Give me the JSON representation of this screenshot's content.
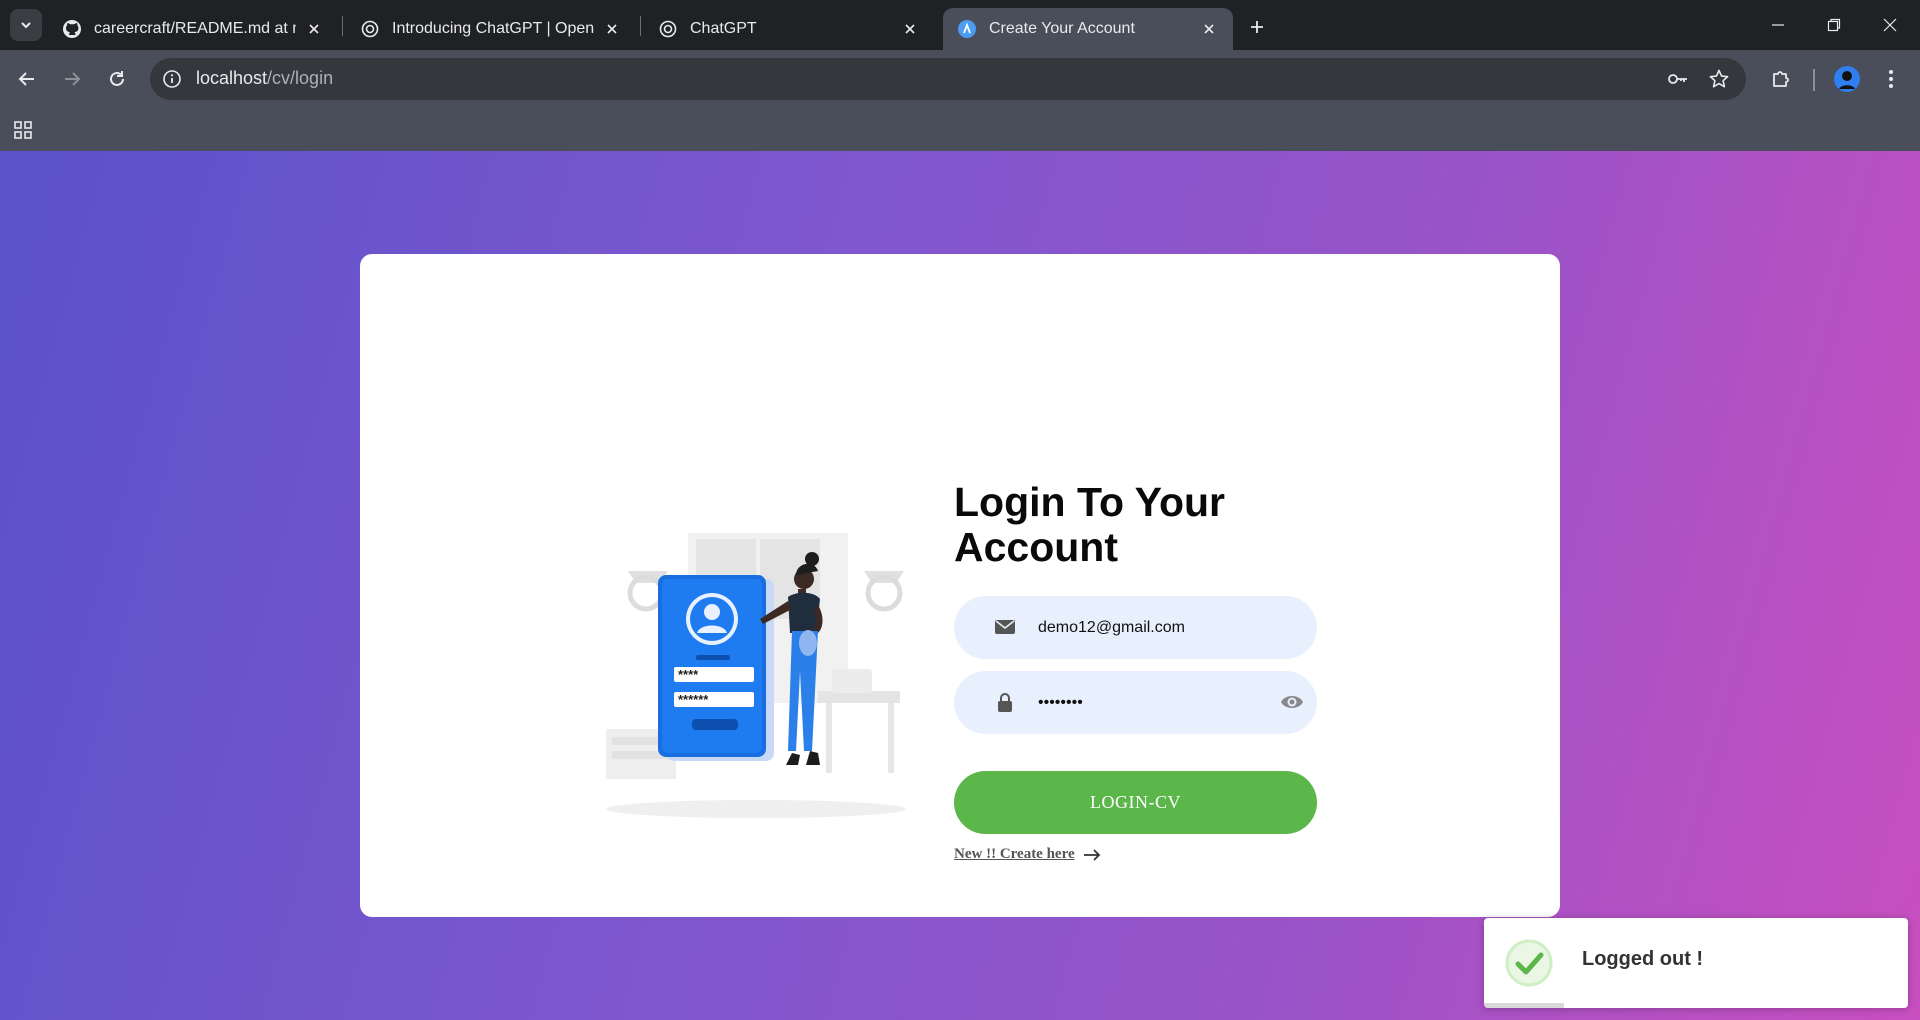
{
  "browser": {
    "tabs": [
      {
        "title": "careercraft/README.md at main",
        "icon": "github-icon",
        "active": false
      },
      {
        "title": "Introducing ChatGPT | OpenAI",
        "icon": "openai-icon",
        "active": false
      },
      {
        "title": "ChatGPT",
        "icon": "openai-icon",
        "active": false
      },
      {
        "title": "Create Your Account",
        "icon": "site-favicon",
        "active": true
      }
    ],
    "url_host": "localhost",
    "url_path": "/cv/login"
  },
  "login": {
    "title": "Login To Your Account",
    "email_value": "demo12@gmail.com",
    "password_value": "demo1234",
    "submit_label": "LOGIN-CV",
    "create_link": "New !! Create here"
  },
  "illustration": {
    "pin_short": "****",
    "pin_long": "******"
  },
  "toast": {
    "message": "Logged out !"
  },
  "colors": {
    "accent_green": "#5bb74a",
    "input_bg": "#e8f0fd",
    "gradient_start": "#5a52c9",
    "gradient_end": "#c94fc0",
    "illustration_blue": "#1e7bf0"
  }
}
